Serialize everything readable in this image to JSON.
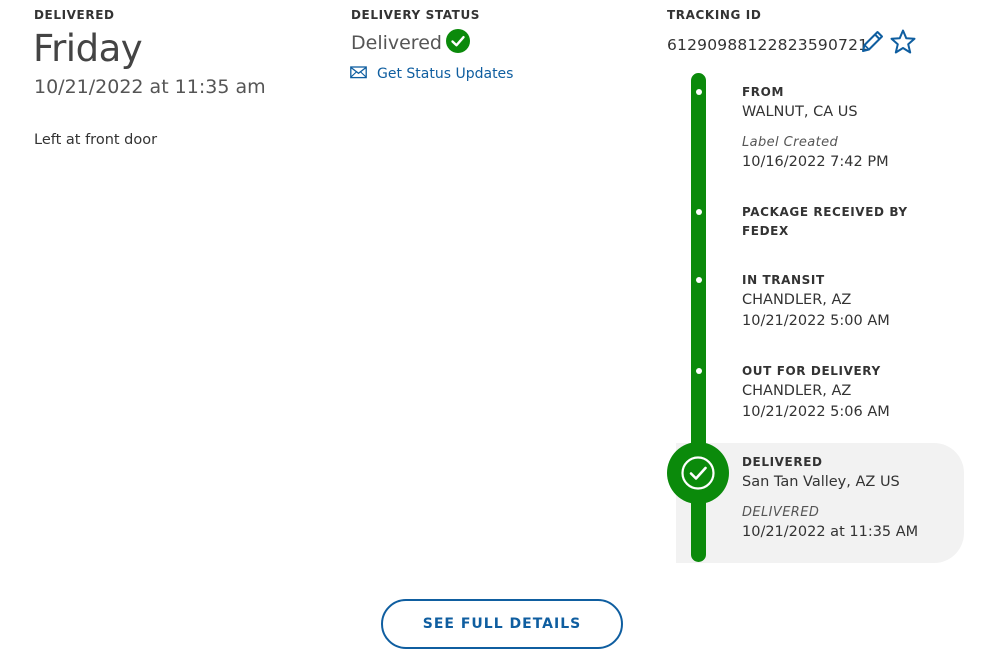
{
  "delivered": {
    "label": "DELIVERED",
    "day": "Friday",
    "datetime": "10/21/2022 at 11:35 am",
    "note": "Left at front door"
  },
  "delivery_status": {
    "label": "DELIVERY STATUS",
    "value": "Delivered",
    "updates_link": "Get Status Updates"
  },
  "tracking": {
    "label": "TRACKING ID",
    "id": "612909881228235907​21"
  },
  "timeline": {
    "from": {
      "title": "FROM",
      "location": "WALNUT, CA US",
      "status": "Label Created",
      "time": "10/16/2022 7:42 PM"
    },
    "received": {
      "title_line1": "PACKAGE RECEIVED BY",
      "title_line2": "FEDEX"
    },
    "transit": {
      "title": "IN TRANSIT",
      "location": "CHANDLER, AZ",
      "time": "10/21/2022 5:00 AM"
    },
    "out": {
      "title": "OUT FOR DELIVERY",
      "location": "CHANDLER, AZ",
      "time": "10/21/2022 5:06 AM"
    },
    "delivered": {
      "title": "DELIVERED",
      "location": "San Tan Valley, AZ US",
      "status": "DELIVERED",
      "time": "10/21/2022 at 11:35 AM"
    }
  },
  "actions": {
    "see_full_details": "SEE FULL DETAILS"
  },
  "colors": {
    "accent_green": "#0b8a0b",
    "link_blue": "#0f5ea0"
  }
}
